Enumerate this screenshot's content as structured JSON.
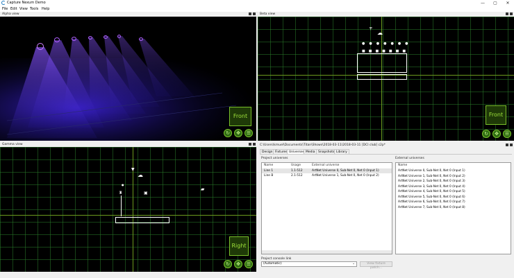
{
  "window": {
    "title": "Capture Nexum Demo",
    "controls": {
      "minimize": "—",
      "maximize": "▢",
      "close": "✕"
    }
  },
  "menu": [
    "File",
    "Edit",
    "View",
    "Tools",
    "Help"
  ],
  "alpha": {
    "title": "Alpha view",
    "camera_label": "Front",
    "light_color": "#7a3cff"
  },
  "beta": {
    "title": "Beta view",
    "camera_label": "Front"
  },
  "gamma": {
    "title": "Gamma view",
    "camera_label": "Right"
  },
  "props": {
    "path": "C:\\Users\\kmuel\\Documents\\Titan\\Shows\\2018-03-11\\2018-03-11 [DCI club] c2p*",
    "tabs": [
      "Design",
      "Fixtures",
      "Universes",
      "Media",
      "Snapshots",
      "Library"
    ],
    "active_tab": "Universes",
    "project_universes": {
      "title": "Project universes",
      "headers": [
        "Name",
        "Usage",
        "External universe"
      ],
      "rows": [
        {
          "name": "Line 1",
          "usage": "1.1-512",
          "external": "ArtNet Universe 0, Sub-Net 0, Net 0 (Input 1)"
        },
        {
          "name": "Line B",
          "usage": "2.1-512",
          "external": "ArtNet Universe 1, Sub-Net 0, Net 0 (Input 2)"
        }
      ]
    },
    "external_universes": {
      "title": "External universes",
      "header": "Name",
      "items": [
        "ArtNet Universe 0, Sub-Net 0, Net 0 (Input 1)",
        "ArtNet Universe 1, Sub-Net 0, Net 0 (Input 2)",
        "ArtNet Universe 2, Sub-Net 0, Net 0 (Input 3)",
        "ArtNet Universe 3, Sub-Net 0, Net 0 (Input 4)",
        "ArtNet Universe 4, Sub-Net 0, Net 0 (Input 5)",
        "ArtNet Universe 5, Sub-Net 0, Net 0 (Input 6)",
        "ArtNet Universe 6, Sub-Net 0, Net 0 (Input 7)",
        "ArtNet Universe 7, Sub-Net 0, Net 0 (Input 8)"
      ]
    },
    "console_link": {
      "label": "Project console link",
      "value": "(Automatic)",
      "button": "View fixture patch..."
    }
  },
  "colors": {
    "grid_axis": "#6c9a1e",
    "accent_green": "#7ac22a",
    "beam_purple": "#7a3cff"
  }
}
